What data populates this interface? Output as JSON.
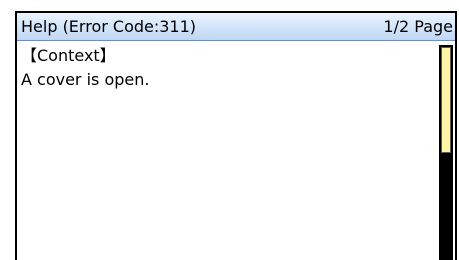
{
  "header": {
    "title": "Help (Error Code:311)",
    "page_indicator": "1/2 Page"
  },
  "content": {
    "section_heading": "【Context】",
    "body": "A cover is open."
  },
  "scrollbar": {
    "position_fraction": 0.0,
    "visible_fraction": 0.5,
    "thumb_color": "#fff6a6",
    "track_color": "#000000"
  },
  "colors": {
    "title_bar": "#d7e7fb",
    "background": "#ffffff",
    "text": "#000000"
  }
}
